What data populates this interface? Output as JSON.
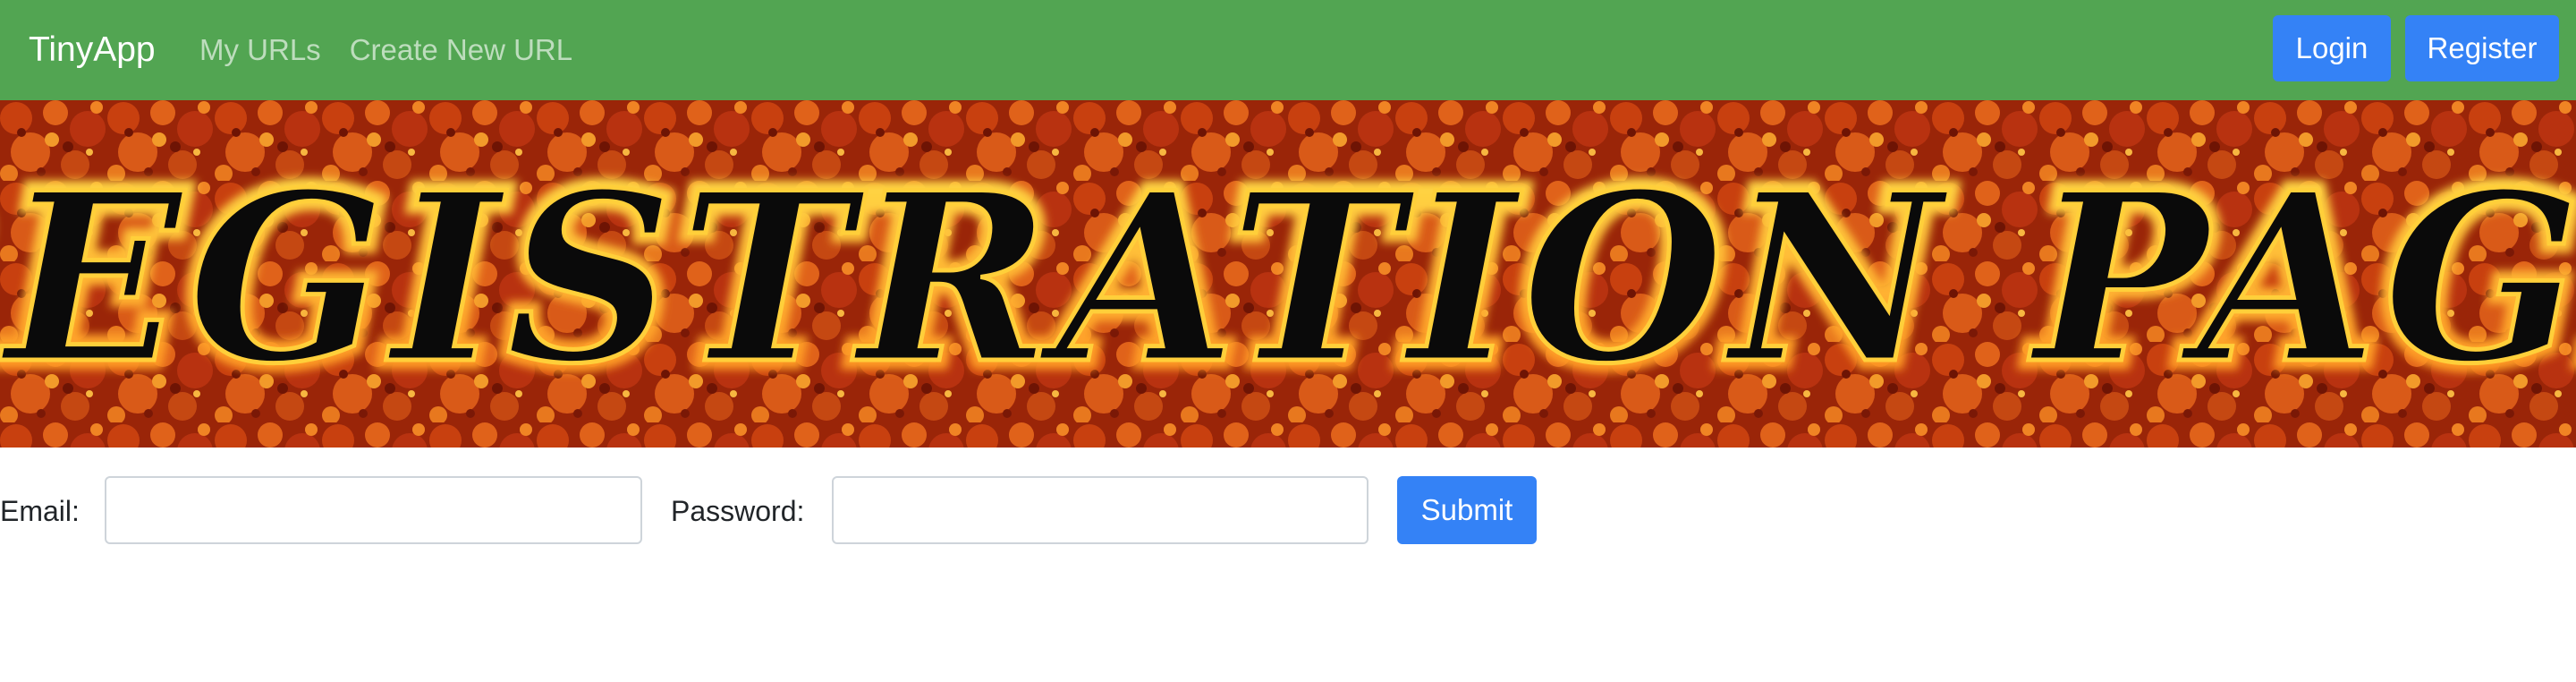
{
  "navbar": {
    "brand": "TinyApp",
    "links": [
      {
        "label": "My URLs"
      },
      {
        "label": "Create New URL"
      }
    ],
    "login_label": "Login",
    "register_label": "Register"
  },
  "banner": {
    "text": "REGISTRATION PAGE",
    "text_color": "#0a0a0a",
    "fire_colors": [
      "#7a1505",
      "#c2410f",
      "#f07a1c",
      "#ffd23a"
    ]
  },
  "form": {
    "email_label": "Email:",
    "email_value": "",
    "password_label": "Password:",
    "password_value": "",
    "submit_label": "Submit"
  },
  "colors": {
    "navbar_bg": "#52a552",
    "button_bg": "#3482f6"
  }
}
